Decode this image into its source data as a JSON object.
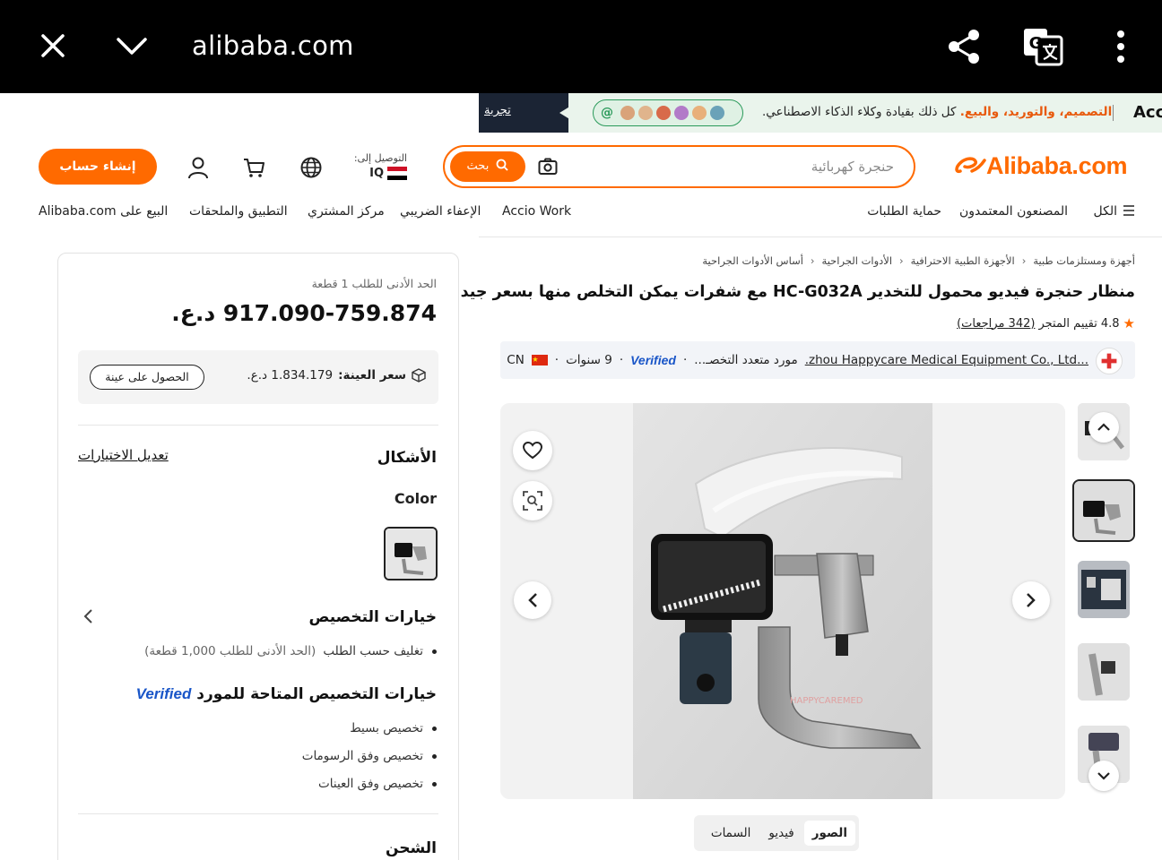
{
  "browser": {
    "url": "alibaba.com"
  },
  "promo": {
    "left_text": "تجربة",
    "highlight": "التصميم، والتوريد، والبيع.",
    "text": " كل ذلك بقيادة وكلاء الذكاء الاصطناعي.",
    "right_text": "Acc"
  },
  "header": {
    "logo": "Alibaba.com",
    "search_placeholder": "حنجرة كهربائية",
    "search_button": "بحث",
    "deliver_label": "التوصيل إلى:",
    "deliver_country": "IQ",
    "create_account": "إنشاء حساب"
  },
  "nav": {
    "all": "الكل",
    "certified_makers": "المصنعون المعتمدون",
    "order_protection": "حماية الطلبات",
    "accio": "Accio Work",
    "tax_exempt": "الإعفاء الضريبي",
    "buyer_center": "مركز المشتري",
    "app": "التطبيق والملحقات",
    "sell": "البيع على Alibaba.com"
  },
  "breadcrumb": [
    "أجهزة ومستلزمات طبية",
    "الأجهزة الطبية الاحترافية",
    "الأدوات الجراحية",
    "أساس الأدوات الجراحية"
  ],
  "product": {
    "title": "منظار حنجرة فيديو محمول للتخدير HC-G032A مع شفرات يمكن التخلص منها بسعر جيد",
    "rating": "4.8",
    "rating_label": "تقييم المتجر",
    "reviews": "(342 مراجعات)"
  },
  "supplier": {
    "name": "...zhou Happycare Medical Equipment Co., Ltd.",
    "type": "مورد متعدد التخصـ...",
    "verified": "Verified",
    "years": "9 سنوات",
    "country": "CN"
  },
  "media_tabs": {
    "photos": "الصور",
    "video": "فيديو",
    "attributes": "السمات"
  },
  "image_watermark": "HAPPYCAREMED",
  "panel": {
    "moq": "الحد الأدنى للطلب 1 قطعة",
    "price": "917.090-759.874 د.ع.",
    "sample_label": "سعر العينة:",
    "sample_price": "1.834.179 د.ع.",
    "sample_button": "الحصول على عينة",
    "variants_title": "الأشكال",
    "edit_options": "تعديل الاختيارات",
    "color_label": "Color",
    "customization_title": "خيارات التخصيص",
    "customization_item": "تغليف حسب الطلب",
    "customization_note": "(الحد الأدنى للطلب 1,000 قطعة)",
    "verified_options_title": "خيارات التخصيص المتاحة للمورد",
    "verified_badge": "Verified",
    "verified_items": [
      "تخصيص بسيط",
      "تخصيص وفق الرسومات",
      "تخصيص وفق العينات"
    ],
    "shipping_title": "الشحن"
  },
  "colors": {
    "accent": "#ff6a00",
    "verified_blue": "#1a56c8"
  }
}
